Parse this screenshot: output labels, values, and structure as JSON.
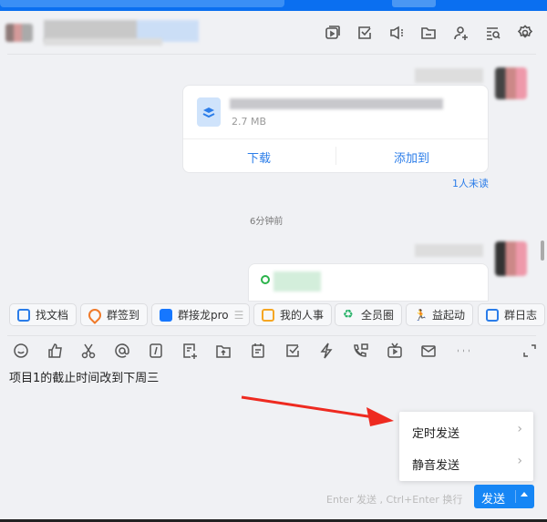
{
  "header": {
    "icons": [
      "screen-share-icon",
      "task-check-icon",
      "announcement-icon",
      "folder-icon",
      "add-member-icon",
      "search-history-icon",
      "settings-gear-icon"
    ]
  },
  "messages": {
    "file": {
      "size": "2.7 MB",
      "download": "下载",
      "add_to": "添加到",
      "read_status": "1人未读"
    },
    "time_divider": "6分钟前"
  },
  "quick_apps": [
    {
      "label": "找文档",
      "color": "#2b7de9"
    },
    {
      "label": "群签到",
      "color": "#f07a2a"
    },
    {
      "label": "群接龙pro",
      "color": "#1677ff"
    },
    {
      "label": "我的人事",
      "color": "#f5a623"
    },
    {
      "label": "全员圈",
      "color": "#2bb36b"
    },
    {
      "label": "益起动",
      "color": "#f04a2a"
    },
    {
      "label": "群日志",
      "color": "#2b7de9"
    }
  ],
  "toolbar": {
    "icons": [
      "emoji-icon",
      "thumbs-up-icon",
      "scissors-icon",
      "mention-icon",
      "slash-command-icon",
      "new-doc-icon",
      "upload-file-icon",
      "calendar-icon",
      "todo-check-icon",
      "lightning-icon",
      "phone-call-icon",
      "live-tv-icon",
      "mail-icon",
      "more-icon",
      "expand-icon"
    ]
  },
  "input": {
    "text": "项目1的截止时间改到下周三"
  },
  "send_menu": {
    "items": [
      "定时发送",
      "静音发送"
    ]
  },
  "footer": {
    "hint": "Enter 发送 , Ctrl+Enter 换行",
    "send": "发送"
  }
}
